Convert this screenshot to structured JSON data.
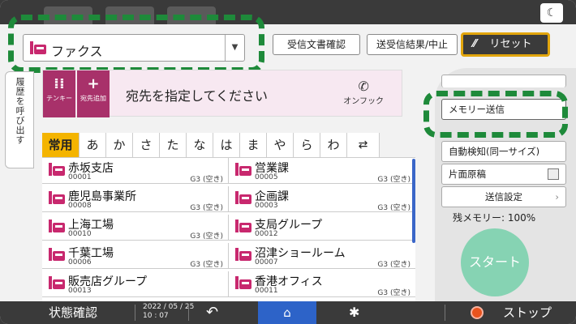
{
  "app": {
    "selected": "ファクス"
  },
  "header": {
    "buttons": {
      "received_docs": "受信文書確認",
      "result_cancel": "送受信結果/中止",
      "reset": "リセット"
    },
    "reset_icon": "slash-icon",
    "moon_icon": "moon-icon"
  },
  "side_tab": "履歴を呼び出す",
  "destination": {
    "message": "宛先を指定してください",
    "onhook": "オンフック",
    "tenkey": "テンキー",
    "add": "宛先追加"
  },
  "tabs": [
    "常用",
    "あ",
    "か",
    "さ",
    "た",
    "な",
    "は",
    "ま",
    "や",
    "ら",
    "わ"
  ],
  "entries": [
    {
      "name": "赤坂支店",
      "no": "00001",
      "status": "G3 (空き)",
      "group": false
    },
    {
      "name": "営業課",
      "no": "00005",
      "status": "G3 (空き)",
      "group": false
    },
    {
      "name": "鹿児島事業所",
      "no": "00008",
      "status": "G3 (空き)",
      "group": false
    },
    {
      "name": "企画課",
      "no": "00003",
      "status": "G3 (空き)",
      "group": false
    },
    {
      "name": "上海工場",
      "no": "00010",
      "status": "G3 (空き)",
      "group": false
    },
    {
      "name": "支局グループ",
      "no": "00012",
      "status": "",
      "group": true
    },
    {
      "name": "千葉工場",
      "no": "00006",
      "status": "G3 (空き)",
      "group": false
    },
    {
      "name": "沼津ショールーム",
      "no": "00007",
      "status": "G3 (空き)",
      "group": false
    },
    {
      "name": "販売店グループ",
      "no": "00013",
      "status": "",
      "group": true
    },
    {
      "name": "香港オフィス",
      "no": "00011",
      "status": "G3 (空き)",
      "group": false
    }
  ],
  "right_panel": {
    "memory_send": "メモリー送信",
    "auto_detect": "自動検知(同一サイズ)",
    "one_side": "片面原稿",
    "send_settings": "送信設定",
    "memory_left": "残メモリー:  100%",
    "start": "スタート"
  },
  "bottom": {
    "status": "状態確認",
    "date": "2022 / 05 / 25",
    "time": "10 : 07",
    "stop": "ストップ"
  },
  "colors": {
    "fax": "#c8286e",
    "highlight": "#1e8a3a",
    "tab_active": "#f4b400",
    "home": "#2d63c8",
    "start": "#86d3b3"
  }
}
